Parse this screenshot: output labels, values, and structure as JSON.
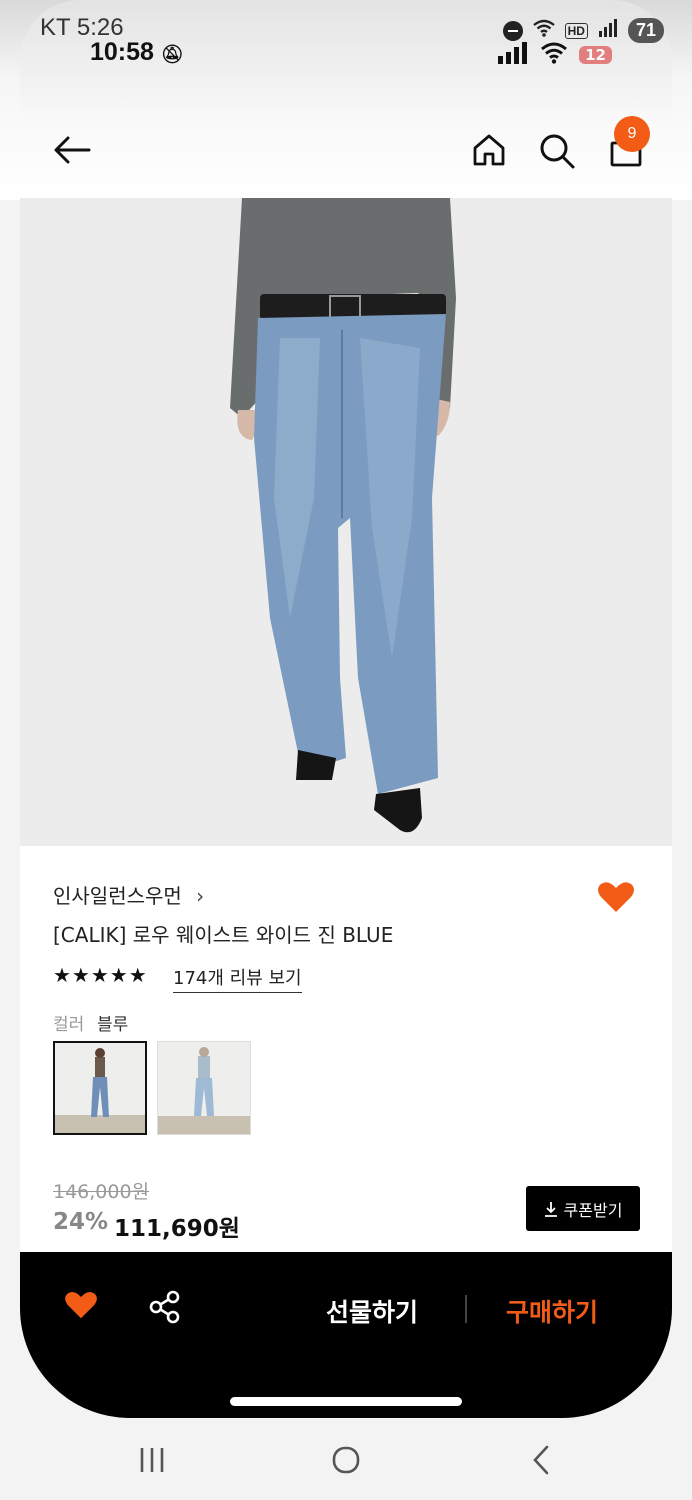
{
  "status_bar": {
    "outer_time": "KT 5:26",
    "inner_time": "10:58",
    "hd_label": "HD",
    "battery_outer": "71",
    "battery_inner": "12"
  },
  "header": {
    "back_icon": "arrow-left-icon",
    "home_icon": "home-icon",
    "search_icon": "search-icon",
    "cart_icon": "shopping-bag-icon",
    "cart_count": "9"
  },
  "product": {
    "brand": "인사일런스우먼",
    "brand_chevron": "›",
    "title": "[CALIK] 로우 웨이스트 와이드 진 BLUE",
    "stars": "★★★★★",
    "reviews_link": "174개 리뷰 보기",
    "color_label": "컬러",
    "color_value": "블루",
    "original_price": "146,000원",
    "discount": "24%",
    "price": "111,690원",
    "coupon_button": "쿠폰받기",
    "wishlist_icon": "heart-icon"
  },
  "bottom_bar": {
    "gift_label": "선물하기",
    "buy_label": "구매하기",
    "wishlist_icon": "heart-icon",
    "share_icon": "share-icon"
  },
  "colors": {
    "accent": "#f25c16",
    "bottom_bar_bg": "#000000"
  }
}
